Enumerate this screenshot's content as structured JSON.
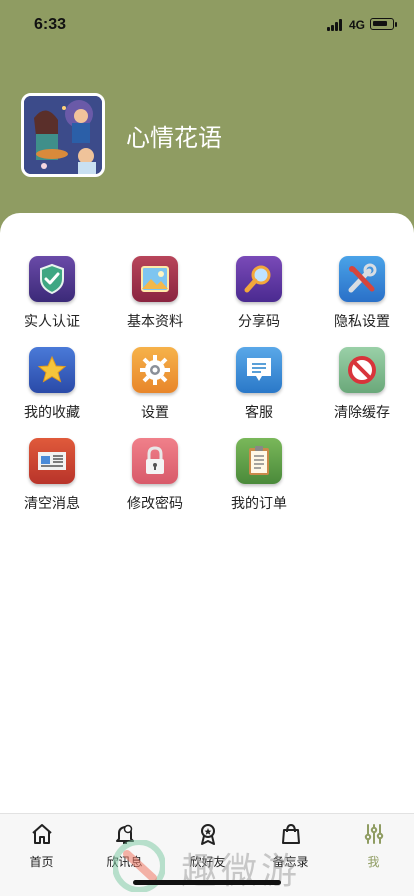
{
  "status_bar": {
    "time": "6:33",
    "network": "4G"
  },
  "profile": {
    "username": "心情花语"
  },
  "menu": {
    "items": [
      {
        "label": "实人认证",
        "icon": "shield-check-icon"
      },
      {
        "label": "基本资料",
        "icon": "image-icon"
      },
      {
        "label": "分享码",
        "icon": "magnifier-icon"
      },
      {
        "label": "隐私设置",
        "icon": "tools-icon"
      },
      {
        "label": "我的收藏",
        "icon": "star-icon"
      },
      {
        "label": "设置",
        "icon": "gear-icon"
      },
      {
        "label": "客服",
        "icon": "chat-bubble-icon"
      },
      {
        "label": "清除缓存",
        "icon": "no-entry-icon"
      },
      {
        "label": "清空消息",
        "icon": "news-icon"
      },
      {
        "label": "修改密码",
        "icon": "lock-icon"
      },
      {
        "label": "我的订单",
        "icon": "clipboard-icon"
      }
    ]
  },
  "tabbar": {
    "items": [
      {
        "label": "首页",
        "icon": "home-icon"
      },
      {
        "label": "欣讯息",
        "icon": "bell-icon"
      },
      {
        "label": "欣好友",
        "icon": "award-icon"
      },
      {
        "label": "备忘录",
        "icon": "bag-icon"
      },
      {
        "label": "我",
        "icon": "sliders-icon",
        "active": true
      }
    ]
  },
  "watermark": {
    "text": "趣微游"
  },
  "colors": {
    "header": "#8f9c62",
    "accent": "#8f9c62"
  }
}
